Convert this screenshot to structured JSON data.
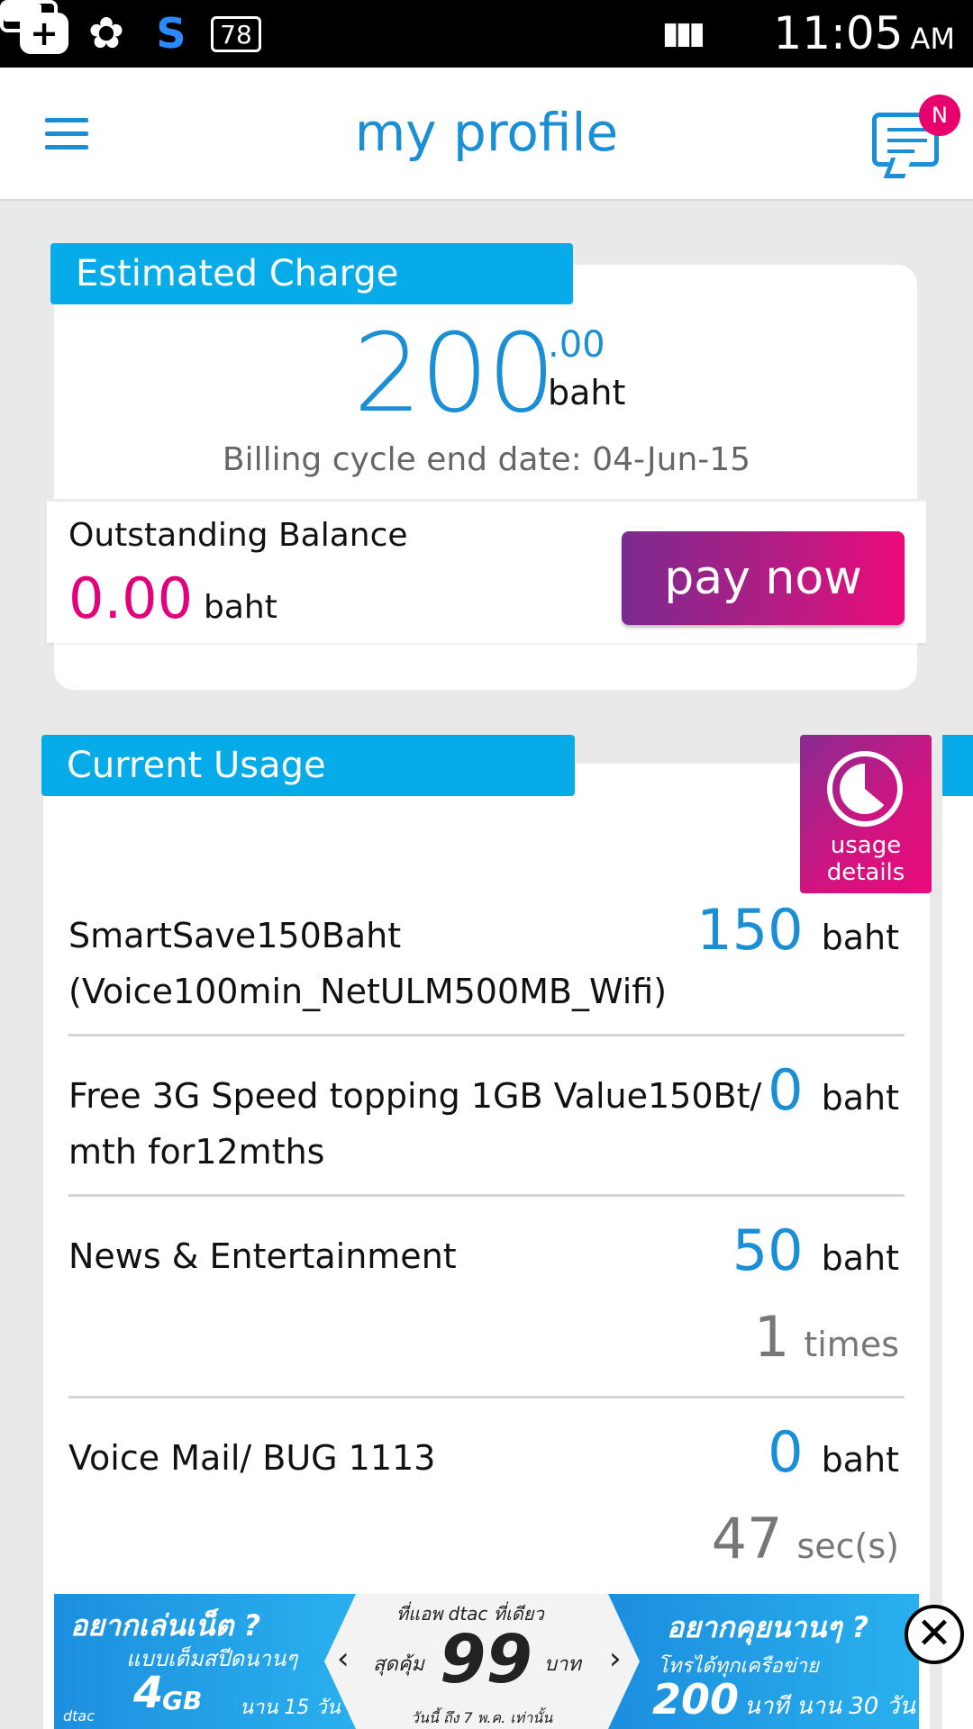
{
  "status_bar": {
    "icons": [
      "plus-box-icon",
      "clover-icon",
      "s-app-icon",
      "notification-78-icon",
      "signal-icon",
      "battery-icon"
    ],
    "badge_count": "78",
    "time": "11:05",
    "ampm": "AM"
  },
  "app_bar": {
    "title": "my profile",
    "notification_badge": "N"
  },
  "estimated_charge": {
    "header": "Estimated Charge",
    "amount": "200",
    "decimals": ".00",
    "unit": "baht",
    "billing_cycle": "Billing cycle end date: 04-Jun-15"
  },
  "outstanding": {
    "label": "Outstanding Balance",
    "amount": "0.00",
    "unit": "baht",
    "pay_label": "pay now"
  },
  "current_usage": {
    "header": "Current Usage",
    "details_line1": "usage",
    "details_line2": "details",
    "rows": [
      {
        "name1": "SmartSave150Baht",
        "name2": "(Voice100min_NetULM500MB_Wifi)",
        "value": "150",
        "unit": "baht"
      },
      {
        "name1": "Free 3G Speed topping 1GB Value150Bt/",
        "name2": "mth for12mths",
        "value": "0",
        "unit": "baht"
      },
      {
        "name1": "News & Entertainment",
        "value": "50",
        "unit": "baht",
        "sub_value": "1",
        "sub_unit": "times"
      },
      {
        "name1": "Voice Mail/ BUG 1113",
        "value": "0",
        "unit": "baht",
        "sub_value": "47",
        "sub_unit": "sec(s)"
      }
    ]
  },
  "ad_banner": {
    "left_line1": "อยากเล่นเน็ต ?",
    "left_line2": "แบบเต็มสปีดนานๆ",
    "left_data": "4",
    "left_unit": "GB",
    "left_duration": "นาน 15 วัน",
    "brand": "dtac",
    "mid_top": "ที่แอพ dtac ที่เดียว",
    "mid_left": "สุดคุ้ม",
    "mid_price": "99",
    "mid_right": "บาท",
    "mid_bottom": "วันนี้ ถึง 7 พ.ค. เท่านั้น",
    "right_line1": "อยากคุยนานๆ ?",
    "right_line2": "โทรได้ทุกเครือข่าย",
    "right_minutes": "200",
    "right_duration": "นาที นาน 30 วัน"
  }
}
